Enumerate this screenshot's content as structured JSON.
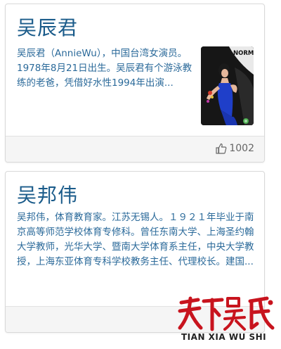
{
  "cards": [
    {
      "title": "吴辰君",
      "description": "吴辰君（AnnieWu），中国台湾女演员。1978年8月21日出生。吴辰君有个游泳教练的老爸，凭借好水性1994年出演...",
      "photo_sign_text": "NORMAN",
      "likes": "1002"
    },
    {
      "title": "吴邦伟",
      "description": "吴邦伟，体育教育家。江苏无锡人。１９２１年毕业于南京高等师范学校体育专修科。曾任东南大学、上海圣约翰大学教师，光华大学、暨南大学体育系主任，中央大学教授，上海东亚体育专科学校教务主任、代理校长。建国..."
    }
  ],
  "watermark": {
    "calligraphy": "天下吴氏",
    "text": "TIAN XIA WU SHI"
  },
  "colors": {
    "title": "#1a5b8a",
    "description": "#2b6a9a",
    "footer_bg": "#f5f5f5",
    "watermark_red": "#c8141e"
  }
}
